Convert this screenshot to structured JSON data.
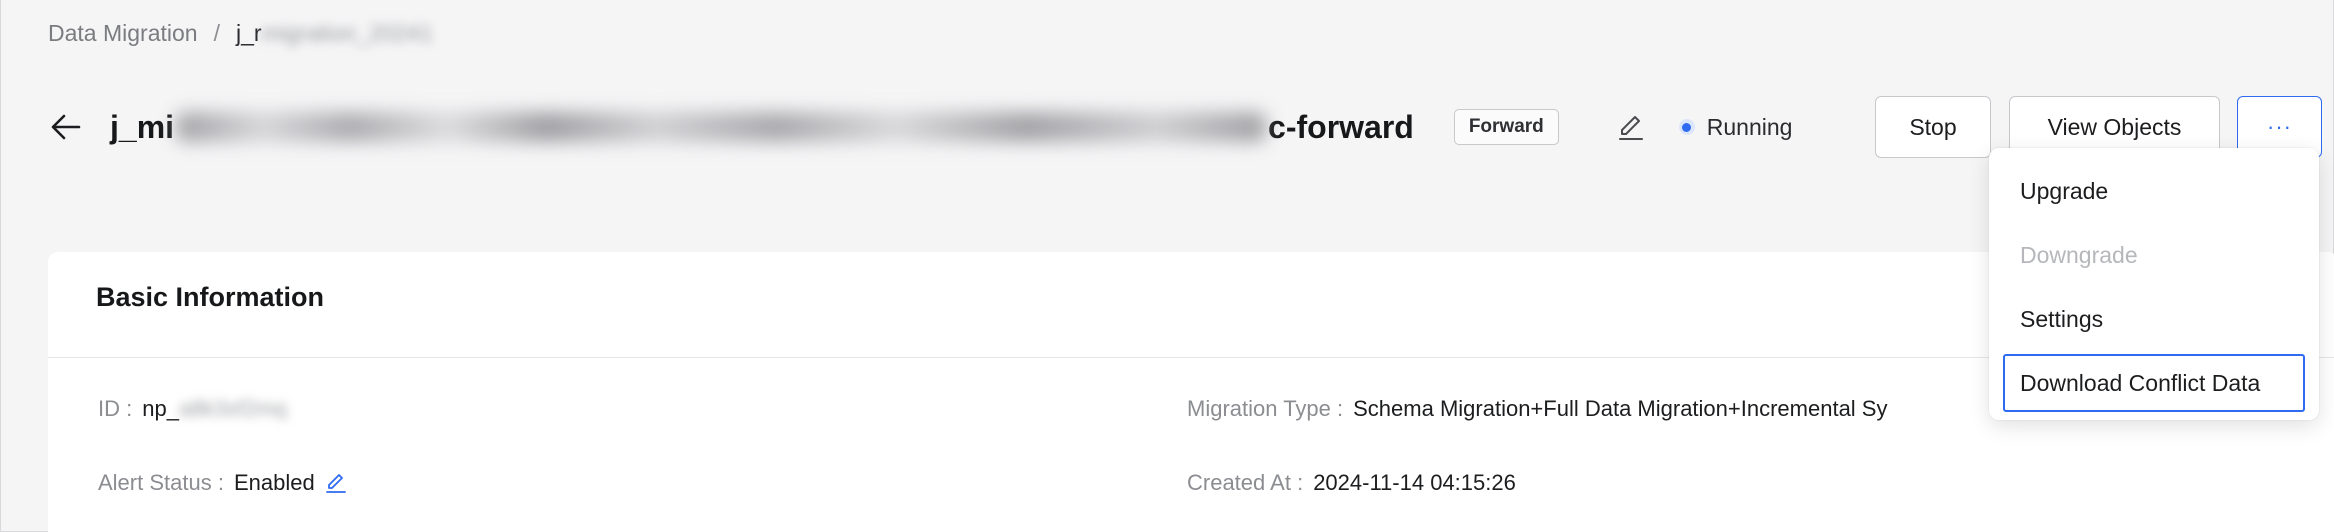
{
  "breadcrumb": {
    "parent": "Data Migration",
    "separator": "/",
    "current_visible": "j_r",
    "current_blurred": "migration_20241"
  },
  "header": {
    "title_prefix": "j_mi",
    "title_suffix": "c-forward",
    "tag": "Forward",
    "status_label": "Running",
    "status_color": "#2f6bf0",
    "stop_label": "Stop",
    "view_objects_label": "View Objects",
    "more_label": "···"
  },
  "dropdown": {
    "items": [
      {
        "label": "Upgrade",
        "disabled": false
      },
      {
        "label": "Downgrade",
        "disabled": true
      },
      {
        "label": "Settings",
        "disabled": false
      },
      {
        "label": "Download Conflict Data",
        "disabled": false,
        "focused": true
      }
    ]
  },
  "basic_info": {
    "title": "Basic Information",
    "id_label": "ID :",
    "id_value_visible": "np_",
    "id_value_blurred": "a8k3xf2mq",
    "alert_label": "Alert Status :",
    "alert_value": "Enabled",
    "migration_type_label": "Migration Type :",
    "migration_type_value": "Schema Migration+Full Data Migration+Incremental Sy",
    "created_label": "Created At :",
    "created_value": "2024-11-14 04:15:26"
  },
  "colors": {
    "accent": "#2f6bf0",
    "background": "#f5f5f6",
    "card": "#ffffff"
  }
}
